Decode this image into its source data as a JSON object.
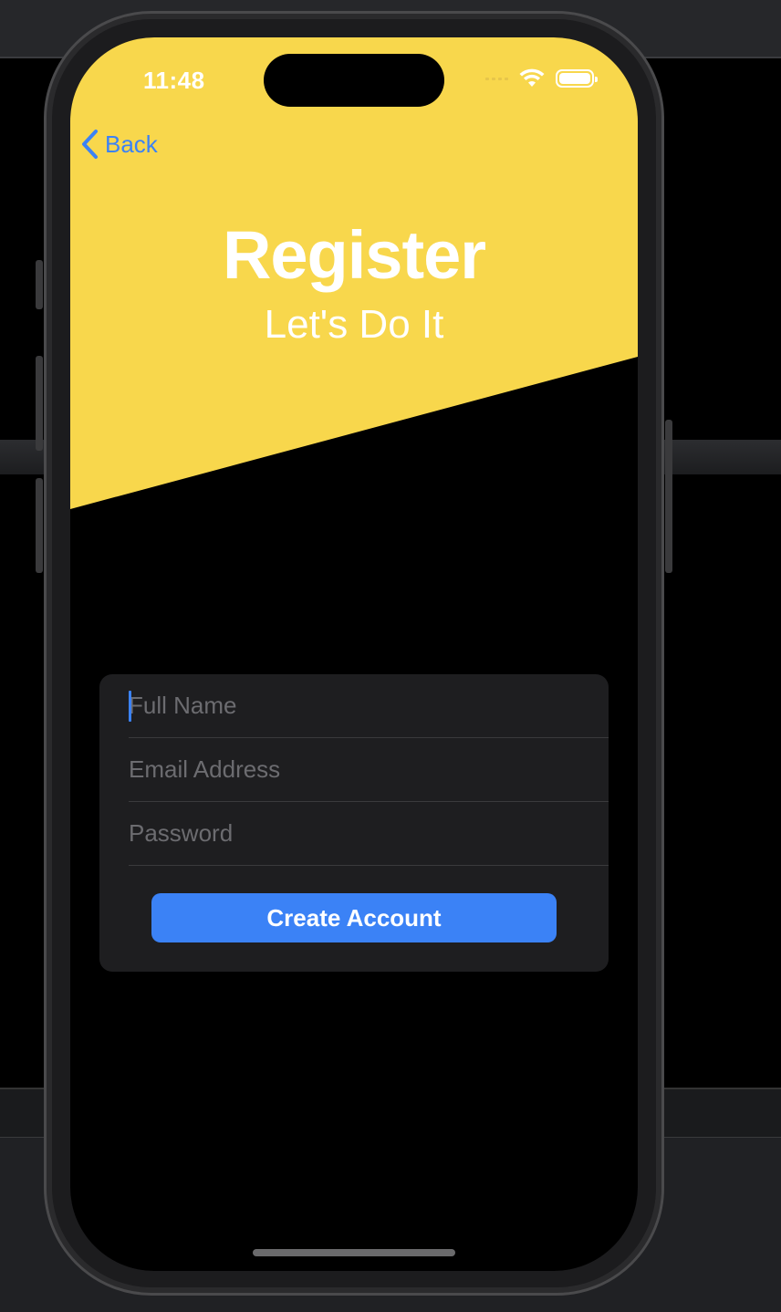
{
  "status_bar": {
    "time": "11:48"
  },
  "nav": {
    "back_label": "Back"
  },
  "header": {
    "title": "Register",
    "subtitle": "Let's Do It"
  },
  "form": {
    "full_name_placeholder": "Full Name",
    "email_placeholder": "Email Address",
    "password_placeholder": "Password",
    "submit_label": "Create Account"
  },
  "colors": {
    "accent": "#3b82f6",
    "header_yellow": "#f8d74c",
    "background": "#000000",
    "card": "#1e1e20"
  }
}
